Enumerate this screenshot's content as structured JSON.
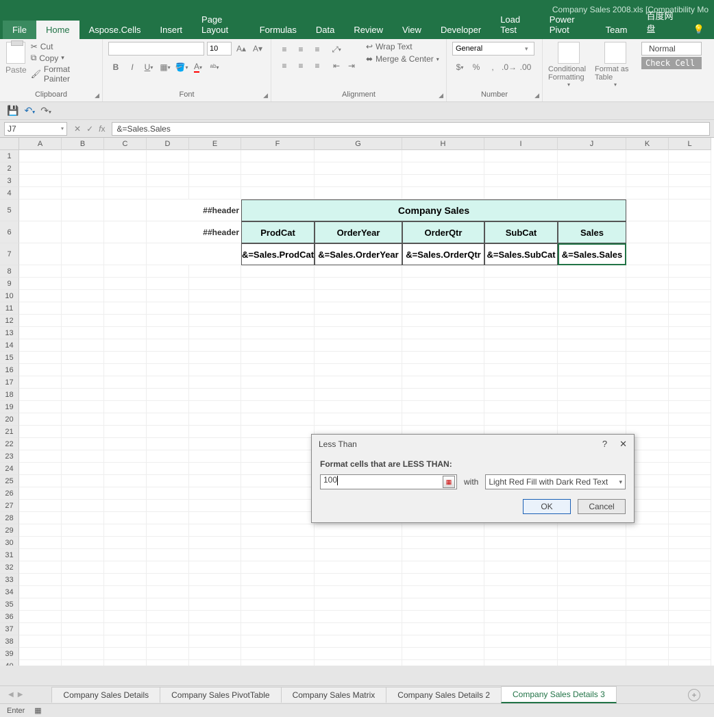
{
  "title": "Company Sales 2008.xls  [Compatibility Mo",
  "ribbon_tabs": {
    "file": "File",
    "home": "Home",
    "aspose": "Aspose.Cells",
    "insert": "Insert",
    "layout": "Page Layout",
    "formulas": "Formulas",
    "data": "Data",
    "review": "Review",
    "view": "View",
    "developer": "Developer",
    "load": "Load Test",
    "pivot": "Power Pivot",
    "team": "Team",
    "baidu": "百度网盘"
  },
  "clipboard": {
    "paste": "Paste",
    "cut": "Cut",
    "copy": "Copy",
    "painter": "Format Painter",
    "label": "Clipboard"
  },
  "font": {
    "size": "10",
    "label": "Font"
  },
  "alignment": {
    "wrap": "Wrap Text",
    "merge": "Merge & Center",
    "label": "Alignment"
  },
  "number": {
    "format": "General",
    "label": "Number"
  },
  "styles": {
    "cond": "Conditional Formatting",
    "table": "Format as Table",
    "normal": "Normal",
    "check": "Check Cell"
  },
  "namebox": "J7",
  "formula": "&=Sales.Sales",
  "cols": [
    "A",
    "B",
    "C",
    "D",
    "E",
    "F",
    "G",
    "H",
    "I",
    "J",
    "K",
    "L"
  ],
  "row5_label": "##header",
  "row6_label": "##header",
  "merged_header": "Company Sales",
  "headers": [
    "ProdCat",
    "OrderYear",
    "OrderQtr",
    "SubCat",
    "Sales"
  ],
  "data_row": [
    "&=Sales.ProdCat",
    "&=Sales.OrderYear",
    "&=Sales.OrderQtr",
    "&=Sales.SubCat",
    "&=Sales.Sales"
  ],
  "dialog": {
    "title": "Less Than",
    "prompt": "Format cells that are LESS THAN:",
    "value": "100",
    "with": "with",
    "format": "Light Red Fill with Dark Red Text",
    "ok": "OK",
    "cancel": "Cancel"
  },
  "sheets": [
    "Company Sales Details",
    "Company Sales PivotTable",
    "Company Sales Matrix",
    "Company Sales Details 2",
    "Company Sales Details 3"
  ],
  "status": "Enter"
}
